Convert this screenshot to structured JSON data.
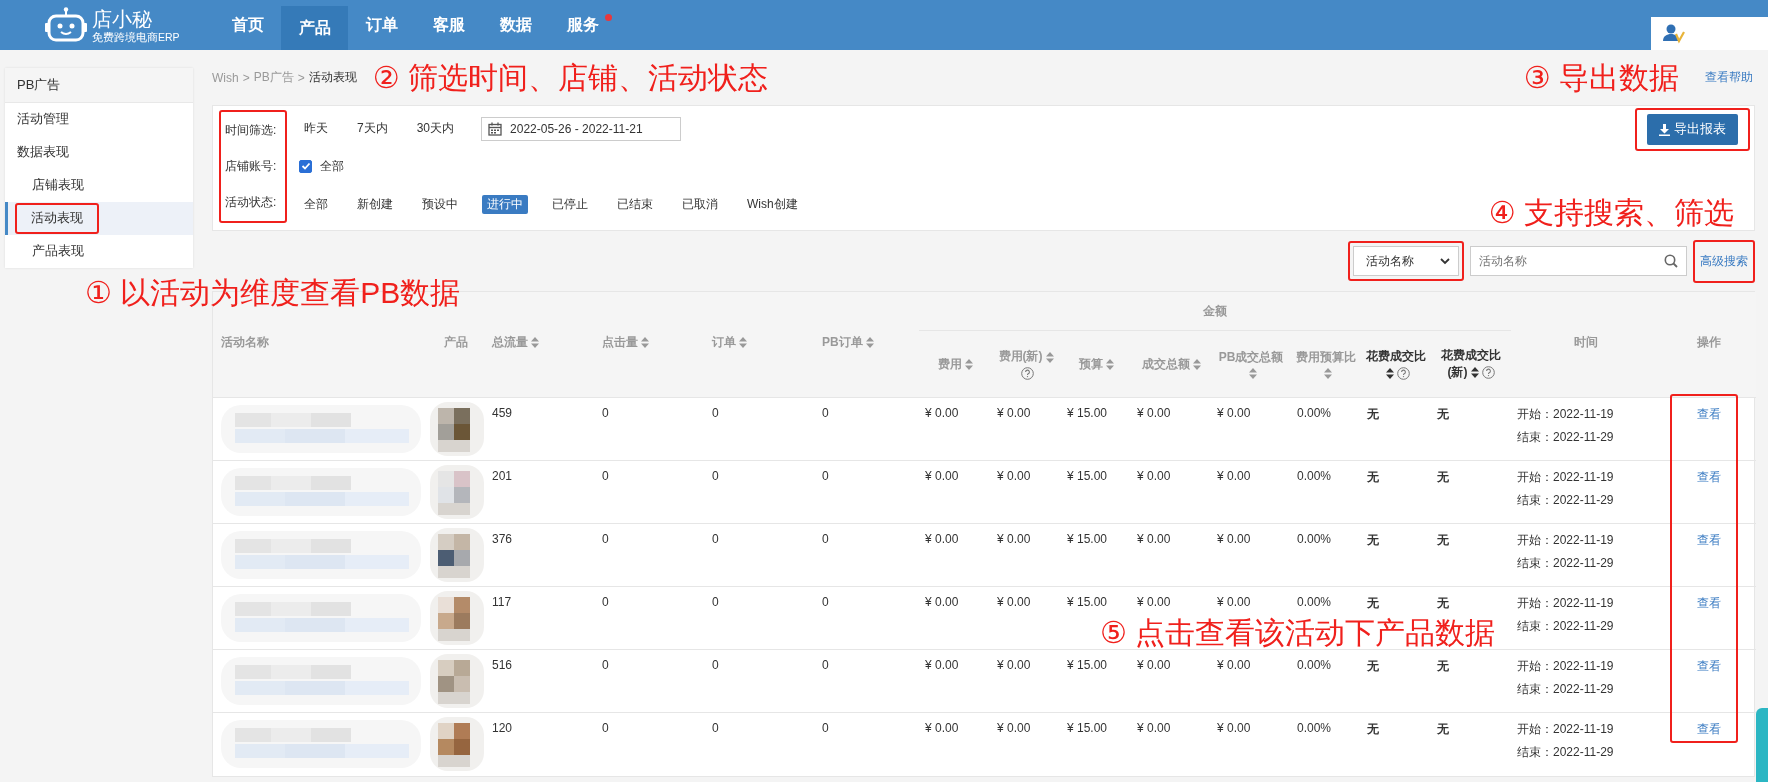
{
  "app": {
    "logo_text": "店小秘",
    "logo_tagline": "免费跨境电商ERP"
  },
  "nav": [
    {
      "label": "首页",
      "selected": false,
      "badge": false
    },
    {
      "label": "产品",
      "selected": true,
      "badge": false
    },
    {
      "label": "订单",
      "selected": false,
      "badge": false
    },
    {
      "label": "客服",
      "selected": false,
      "badge": false
    },
    {
      "label": "数据",
      "selected": false,
      "badge": false
    },
    {
      "label": "服务",
      "selected": false,
      "badge": true
    }
  ],
  "sidebar": {
    "title": "PB广告",
    "items": [
      {
        "label": "活动管理",
        "selected": false,
        "highlighted": false
      },
      {
        "label": "数据表现",
        "selected": false,
        "highlighted": false,
        "children": [
          {
            "label": "店铺表现",
            "selected": false,
            "highlighted": false
          },
          {
            "label": "活动表现",
            "selected": true,
            "highlighted": true
          },
          {
            "label": "产品表现",
            "selected": false,
            "highlighted": false
          }
        ]
      }
    ]
  },
  "breadcrumb": {
    "items": [
      "Wish",
      "PB广告",
      "活动表现"
    ],
    "separator": ">"
  },
  "filter_note": "② 筛选时间、店铺、活动状态",
  "export_note": "③ 导出数据",
  "help_link": "查看帮助",
  "filters": {
    "highlighted": true,
    "time": {
      "label": "时间筛选:",
      "options": [
        {
          "label": "昨天",
          "selected": false
        },
        {
          "label": "7天内",
          "selected": false
        },
        {
          "label": "30天内",
          "selected": false
        }
      ],
      "date_range": "2022-05-26 - 2022-11-21"
    },
    "store": {
      "label": "店铺账号:",
      "checkbox_label": "全部",
      "checked": true
    },
    "status": {
      "label": "活动状态:",
      "options": [
        {
          "label": "全部",
          "selected": false
        },
        {
          "label": "新创建",
          "selected": false
        },
        {
          "label": "预设中",
          "selected": false
        },
        {
          "label": "进行中",
          "selected": true
        },
        {
          "label": "已停止",
          "selected": false
        },
        {
          "label": "已结束",
          "selected": false
        },
        {
          "label": "已取消",
          "selected": false
        },
        {
          "label": "Wish创建",
          "selected": false
        }
      ]
    }
  },
  "export_button": {
    "label": "导出报表",
    "highlighted": true
  },
  "search_note": "④ 支持搜索、筛选",
  "search": {
    "select_value": "活动名称",
    "placeholder": "活动名称",
    "advanced_link": "高级搜索",
    "highlighted": true
  },
  "dimension_note": "① 以活动为维度查看PB数据",
  "table": {
    "group_header": "金额",
    "actions_highlighted": true,
    "columns": [
      {
        "label": "活动名称",
        "sortable": false,
        "help": false,
        "emphasis": false,
        "group": false
      },
      {
        "label": "产品",
        "sortable": false,
        "help": false,
        "emphasis": false,
        "group": false
      },
      {
        "label": "总流量",
        "sortable": true,
        "help": false,
        "emphasis": false,
        "group": false
      },
      {
        "label": "点击量",
        "sortable": true,
        "help": false,
        "emphasis": false,
        "group": false
      },
      {
        "label": "订单",
        "sortable": true,
        "help": false,
        "emphasis": false,
        "group": false
      },
      {
        "label": "PB订单",
        "sortable": true,
        "help": false,
        "emphasis": false,
        "group": false
      },
      {
        "label": "费用",
        "sortable": true,
        "help": false,
        "emphasis": false,
        "group": true
      },
      {
        "label": "费用(新)",
        "sortable": true,
        "help": true,
        "emphasis": false,
        "group": true
      },
      {
        "label": "预算",
        "sortable": true,
        "help": false,
        "emphasis": false,
        "group": true
      },
      {
        "label": "成交总额",
        "sortable": true,
        "help": false,
        "emphasis": false,
        "group": true
      },
      {
        "label": "PB成交总额",
        "sortable": true,
        "help": false,
        "emphasis": false,
        "group": true
      },
      {
        "label": "费用预算比",
        "sortable": true,
        "help": false,
        "emphasis": false,
        "group": true
      },
      {
        "label": "花费成交比",
        "sortable": true,
        "help": true,
        "emphasis": true,
        "group": true
      },
      {
        "label": "花费成交比(新)",
        "sortable": true,
        "help": true,
        "emphasis": true,
        "group": true
      },
      {
        "label": "时间",
        "sortable": false,
        "help": false,
        "emphasis": false,
        "group": false
      },
      {
        "label": "操作",
        "sortable": false,
        "help": false,
        "emphasis": false,
        "group": false
      }
    ],
    "rows": [
      {
        "cells": [
          "",
          "",
          "459",
          "0",
          "0",
          "0",
          "¥ 0.00",
          "¥ 0.00",
          "¥ 15.00",
          "¥ 0.00",
          "¥ 0.00",
          "0.00%",
          "无",
          "无"
        ],
        "start": "开始：2022-11-19",
        "end": "结束：2022-11-29",
        "action": "查看"
      },
      {
        "cells": [
          "",
          "",
          "201",
          "0",
          "0",
          "0",
          "¥ 0.00",
          "¥ 0.00",
          "¥ 15.00",
          "¥ 0.00",
          "¥ 0.00",
          "0.00%",
          "无",
          "无"
        ],
        "start": "开始：2022-11-19",
        "end": "结束：2022-11-29",
        "action": "查看"
      },
      {
        "cells": [
          "",
          "",
          "376",
          "0",
          "0",
          "0",
          "¥ 0.00",
          "¥ 0.00",
          "¥ 15.00",
          "¥ 0.00",
          "¥ 0.00",
          "0.00%",
          "无",
          "无"
        ],
        "start": "开始：2022-11-19",
        "end": "结束：2022-11-29",
        "action": "查看"
      },
      {
        "cells": [
          "",
          "",
          "117",
          "0",
          "0",
          "0",
          "¥ 0.00",
          "¥ 0.00",
          "¥ 15.00",
          "¥ 0.00",
          "¥ 0.00",
          "0.00%",
          "无",
          "无"
        ],
        "start": "开始：2022-11-19",
        "end": "结束：2022-11-29",
        "action": "查看"
      },
      {
        "cells": [
          "",
          "",
          "516",
          "0",
          "0",
          "0",
          "¥ 0.00",
          "¥ 0.00",
          "¥ 15.00",
          "¥ 0.00",
          "¥ 0.00",
          "0.00%",
          "无",
          "无"
        ],
        "start": "开始：2022-11-19",
        "end": "结束：2022-11-29",
        "action": "查看"
      },
      {
        "cells": [
          "",
          "",
          "120",
          "0",
          "0",
          "0",
          "¥ 0.00",
          "¥ 0.00",
          "¥ 15.00",
          "¥ 0.00",
          "¥ 0.00",
          "0.00%",
          "无",
          "无"
        ],
        "start": "开始：2022-11-19",
        "end": "结束：2022-11-29",
        "action": "查看"
      }
    ]
  },
  "action_note": "⑤ 点击查看该活动下产品数据"
}
